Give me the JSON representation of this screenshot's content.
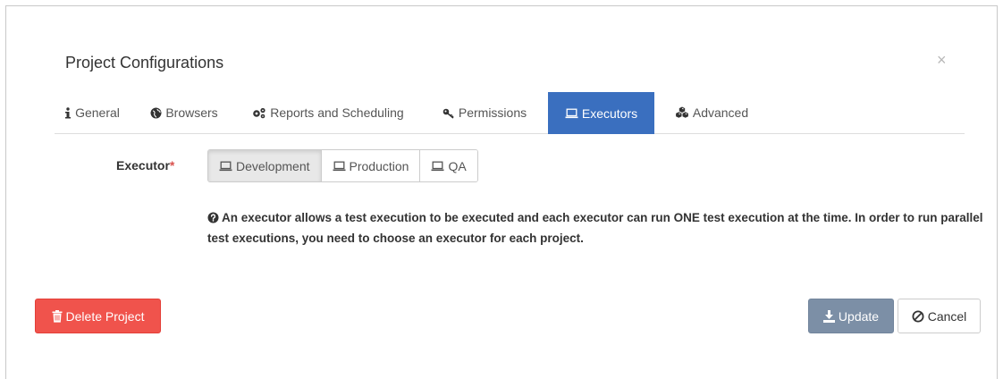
{
  "modal": {
    "title": "Project Configurations",
    "close_glyph": "×",
    "close_icon": "close-icon"
  },
  "tabs": [
    {
      "label": "General",
      "icon": "info-icon"
    },
    {
      "label": "Browsers",
      "icon": "globe-icon"
    },
    {
      "label": "Reports and Scheduling",
      "icon": "gears-icon"
    },
    {
      "label": "Permissions",
      "icon": "key-icon"
    },
    {
      "label": "Executors",
      "icon": "laptop-icon",
      "active": true
    },
    {
      "label": "Advanced",
      "icon": "cubes-icon"
    }
  ],
  "executor": {
    "label": "Executor",
    "required_mark": "*",
    "options": [
      {
        "label": "Development",
        "icon": "laptop-icon",
        "selected": true
      },
      {
        "label": "Production",
        "icon": "laptop-icon"
      },
      {
        "label": "QA",
        "icon": "laptop-icon"
      }
    ],
    "help_icon": "question-circle-icon",
    "help_text": "An executor allows a test execution to be executed and each executor can run ONE test execution at the time. In order to run parallel test executions, you need to choose an executor for each project."
  },
  "footer": {
    "delete_label": "Delete Project",
    "delete_icon": "trash-icon",
    "update_label": "Update",
    "update_icon": "download-icon",
    "cancel_label": "Cancel",
    "cancel_icon": "ban-icon"
  },
  "colors": {
    "active_tab": "#3a6fbf",
    "delete": "#f0534c",
    "update": "#7c8fa6",
    "required": "#d9534f"
  }
}
